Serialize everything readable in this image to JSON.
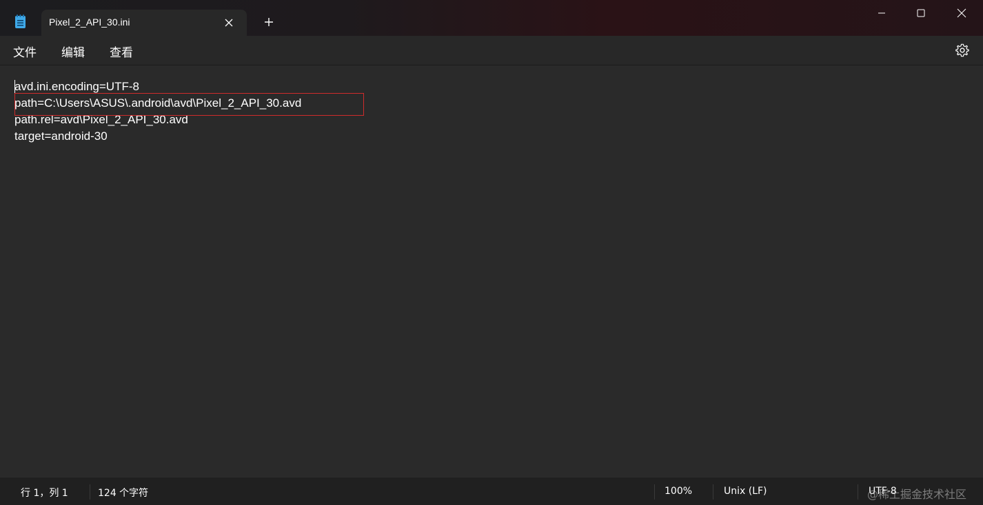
{
  "window": {
    "tab_title": "Pixel_2_API_30.ini",
    "icons": {
      "app": "notepad-icon",
      "tab_close": "close-icon",
      "new_tab": "plus-icon",
      "minimize": "minimize-icon",
      "maximize": "maximize-icon",
      "close": "close-icon"
    }
  },
  "menu": {
    "file": "文件",
    "edit": "编辑",
    "view": "查看",
    "settings_icon": "gear-icon"
  },
  "editor": {
    "lines": [
      "avd.ini.encoding=UTF-8",
      "path=C:\\Users\\ASUS\\.android\\avd\\Pixel_2_API_30.avd",
      "path.rel=avd\\Pixel_2_API_30.avd",
      "target=android-30"
    ],
    "highlight_color": "#d02c2c"
  },
  "status": {
    "position": "行 1，列 1",
    "char_count": "124 个字符",
    "zoom": "100%",
    "line_ending": "Unix (LF)",
    "encoding": "UTF-8",
    "watermark": "@稀土掘金技术社区"
  }
}
